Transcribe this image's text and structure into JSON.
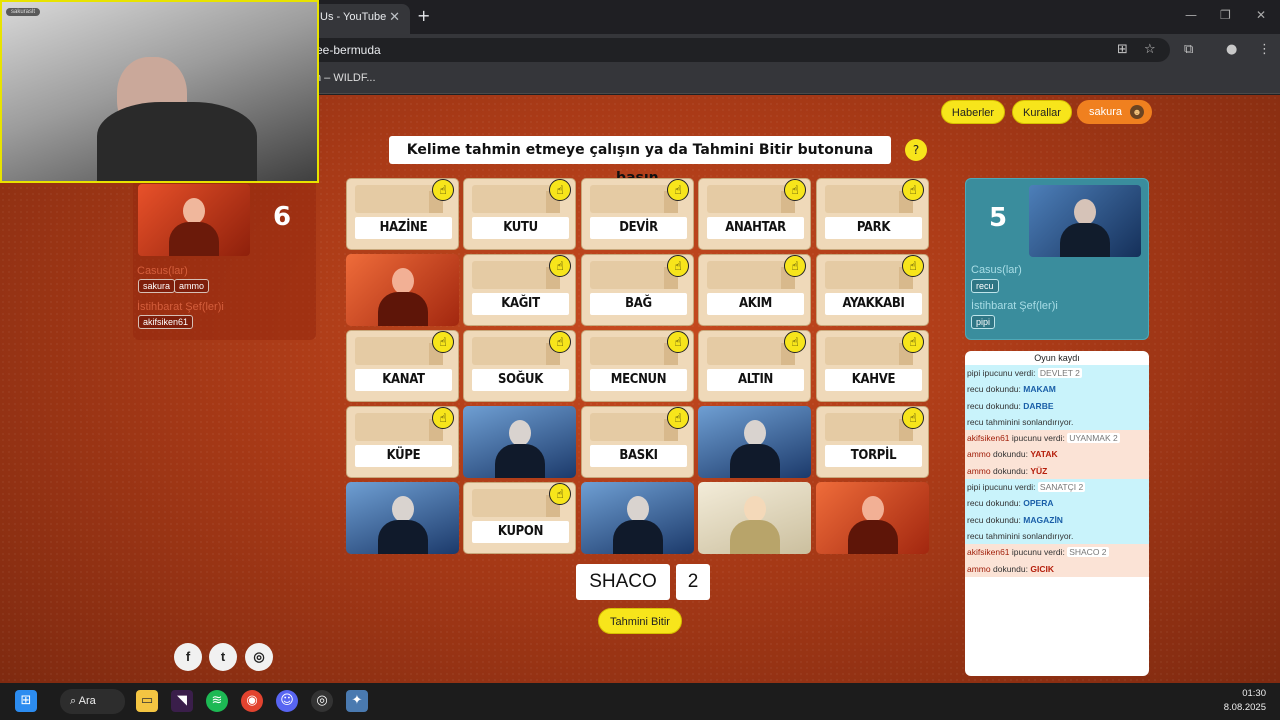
{
  "browser": {
    "tab_title": "Us - YouTube",
    "tab_close": "✕",
    "new_tab": "+",
    "url": "ee-bermuda",
    "bookmark": "h – WILDF..."
  },
  "header": {
    "news_label": "Haberler",
    "rules_label": "Kurallar",
    "user_label": "sakura"
  },
  "instruction": "Kelime tahmin etmeye çalışın ya da Tahmini Bitir butonuna basın.",
  "help_label": "?",
  "red_team": {
    "score": "6",
    "spies_label": "Casus(lar)",
    "spies": [
      "sakura",
      "ammo"
    ],
    "chief_label": "İstihbarat Şef(ler)i",
    "chiefs": [
      "akifsiken61"
    ]
  },
  "blue_team": {
    "score": "5",
    "spies_label": "Casus(lar)",
    "spies": [
      "recu"
    ],
    "chief_label": "İstihbarat Şef(ler)i",
    "chiefs": [
      "pipi"
    ]
  },
  "cards": [
    {
      "word": "HAZİNE",
      "hand": true
    },
    {
      "word": "KUTU",
      "hand": true
    },
    {
      "word": "DEVİR",
      "hand": true
    },
    {
      "word": "ANAHTAR",
      "hand": true
    },
    {
      "word": "PARK",
      "hand": true
    },
    {
      "agent": "red"
    },
    {
      "word": "KAĞIT",
      "hand": true
    },
    {
      "word": "BAĞ",
      "hand": true
    },
    {
      "word": "AKIM",
      "hand": true
    },
    {
      "word": "AYAKKABI",
      "hand": true
    },
    {
      "word": "KANAT",
      "hand": true
    },
    {
      "word": "SOĞUK",
      "hand": true
    },
    {
      "word": "MECNUN",
      "hand": true
    },
    {
      "word": "ALTIN",
      "hand": true
    },
    {
      "word": "KAHVE",
      "hand": true
    },
    {
      "word": "KÜPE",
      "hand": true
    },
    {
      "agent": "blue"
    },
    {
      "word": "BASKI",
      "hand": true
    },
    {
      "agent": "blue"
    },
    {
      "word": "TORPİL",
      "hand": true
    },
    {
      "agent": "blue"
    },
    {
      "word": "KUPON",
      "hand": true
    },
    {
      "agent": "blue"
    },
    {
      "agent": "neutral"
    },
    {
      "agent": "red"
    }
  ],
  "clue": {
    "word": "SHACO",
    "number": "2"
  },
  "finish_label": "Tahmini Bitir",
  "social": [
    "f",
    "t",
    "◎"
  ],
  "log": {
    "title": "Oyun kaydı",
    "rows": [
      {
        "team": "blue",
        "user": "pipi",
        "verb": "ipucunu verdi:",
        "clue": "DEVLET 2"
      },
      {
        "team": "blue",
        "user": "recu",
        "verb": "dokundu:",
        "word": "MAKAM"
      },
      {
        "team": "blue",
        "user": "recu",
        "verb": "dokundu:",
        "word": "DARBE"
      },
      {
        "team": "blue",
        "user": "recu",
        "verb": "tahminini sonlandırıyor."
      },
      {
        "team": "red",
        "user": "akifsiken61",
        "verb": "ipucunu verdi:",
        "clue": "UYANMAK 2"
      },
      {
        "team": "red",
        "user": "ammo",
        "verb": "dokundu:",
        "word": "YATAK"
      },
      {
        "team": "red",
        "user": "ammo",
        "verb": "dokundu:",
        "word": "YÜZ"
      },
      {
        "team": "blue",
        "user": "pipi",
        "verb": "ipucunu verdi:",
        "clue": "SANATÇI 2"
      },
      {
        "team": "blue",
        "user": "recu",
        "verb": "dokundu:",
        "word": "OPERA"
      },
      {
        "team": "blue",
        "user": "recu",
        "verb": "dokundu:",
        "word": "MAGAZİN"
      },
      {
        "team": "blue",
        "user": "recu",
        "verb": "tahminini sonlandırıyor."
      },
      {
        "team": "red",
        "user": "akifsiken61",
        "verb": "ipucunu verdi:",
        "clue": "SHACO 2"
      },
      {
        "team": "red",
        "user": "ammo",
        "verb": "dokundu:",
        "word": "GICIK"
      }
    ]
  },
  "webcam": {
    "label": "sakuraslt"
  },
  "taskbar": {
    "search_label": "Ara",
    "time": "01:30",
    "date": "8.08.2025"
  },
  "colors": {
    "red_team": "#a93a17",
    "blue_team": "#3a8d9d",
    "accent": "#f7e51b"
  }
}
